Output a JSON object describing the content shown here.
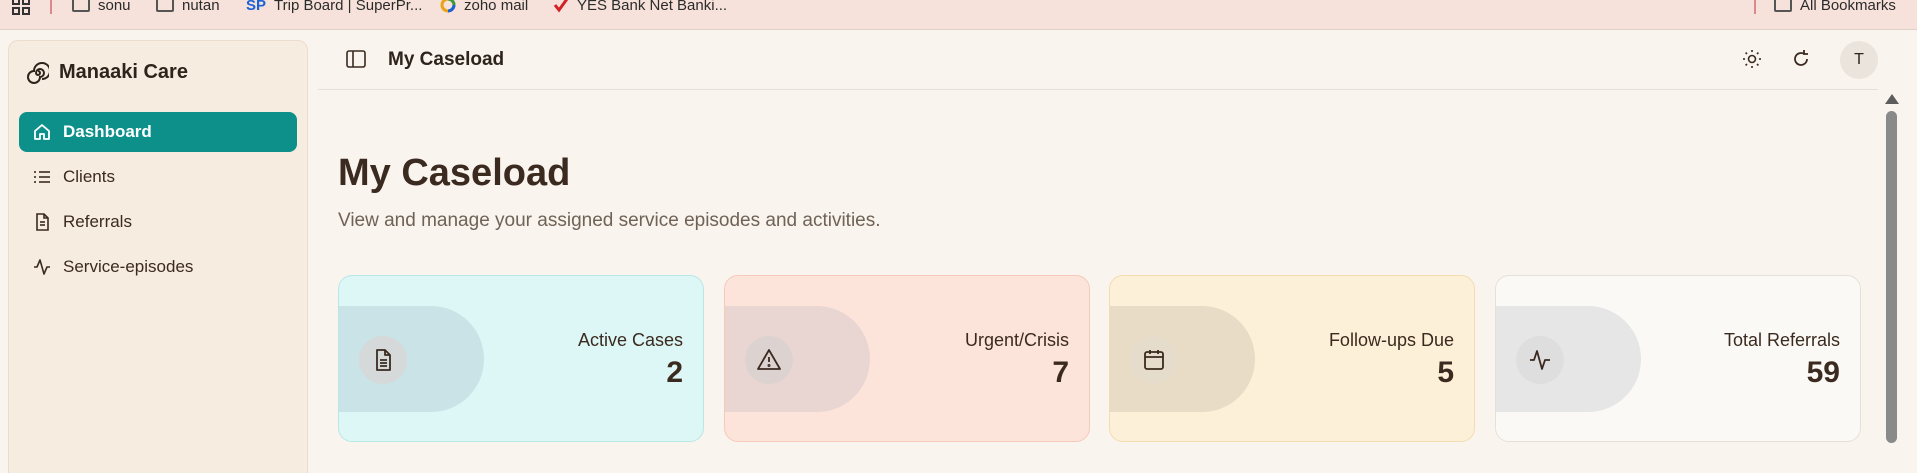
{
  "bookmarks": {
    "items": [
      {
        "label": "sonu",
        "icon": "folder-icon"
      },
      {
        "label": "nutan",
        "icon": "folder-icon"
      },
      {
        "label": "Trip Board | SuperPr...",
        "icon": "sp-icon",
        "icon_text": "SP"
      },
      {
        "label": "zoho mail",
        "icon": "zoho-icon"
      },
      {
        "label": "YES Bank Net Banki...",
        "icon": "yes-bank-icon"
      }
    ],
    "all_bookmarks": "All Bookmarks"
  },
  "sidebar": {
    "brand": "Manaaki Care",
    "items": [
      {
        "label": "Dashboard",
        "icon": "home-icon",
        "active": true
      },
      {
        "label": "Clients",
        "icon": "list-icon",
        "active": false
      },
      {
        "label": "Referrals",
        "icon": "document-icon",
        "active": false
      },
      {
        "label": "Service-episodes",
        "icon": "activity-icon",
        "active": false
      }
    ]
  },
  "header": {
    "title": "My Caseload",
    "avatar_initial": "T"
  },
  "main": {
    "title": "My Caseload",
    "subtitle": "View and manage your assigned service episodes and activities."
  },
  "cards": [
    {
      "label": "Active Cases",
      "value": "2",
      "icon": "file-text-icon",
      "bg": "#dcf7f6",
      "blob": "#cae3e6",
      "border": "#b9e7e6"
    },
    {
      "label": "Urgent/Crisis",
      "value": "7",
      "icon": "alert-triangle-icon",
      "bg": "#fde4db",
      "blob": "#e9d5d2",
      "border": "#f6c9bb"
    },
    {
      "label": "Follow-ups Due",
      "value": "5",
      "icon": "calendar-icon",
      "bg": "#fdf0d8",
      "blob": "#e9dcc6",
      "border": "#f4dcb0"
    },
    {
      "label": "Total Referrals",
      "value": "59",
      "icon": "activity-icon",
      "bg": "#fbf9f5",
      "blob": "#e6e6e6",
      "border": "#e6e0d8"
    }
  ],
  "colors": {
    "accent": "#0d8f8a",
    "background": "#f9f4ee",
    "sidebar_bg": "#f7ece0",
    "text_dark": "#3b2a1f"
  }
}
